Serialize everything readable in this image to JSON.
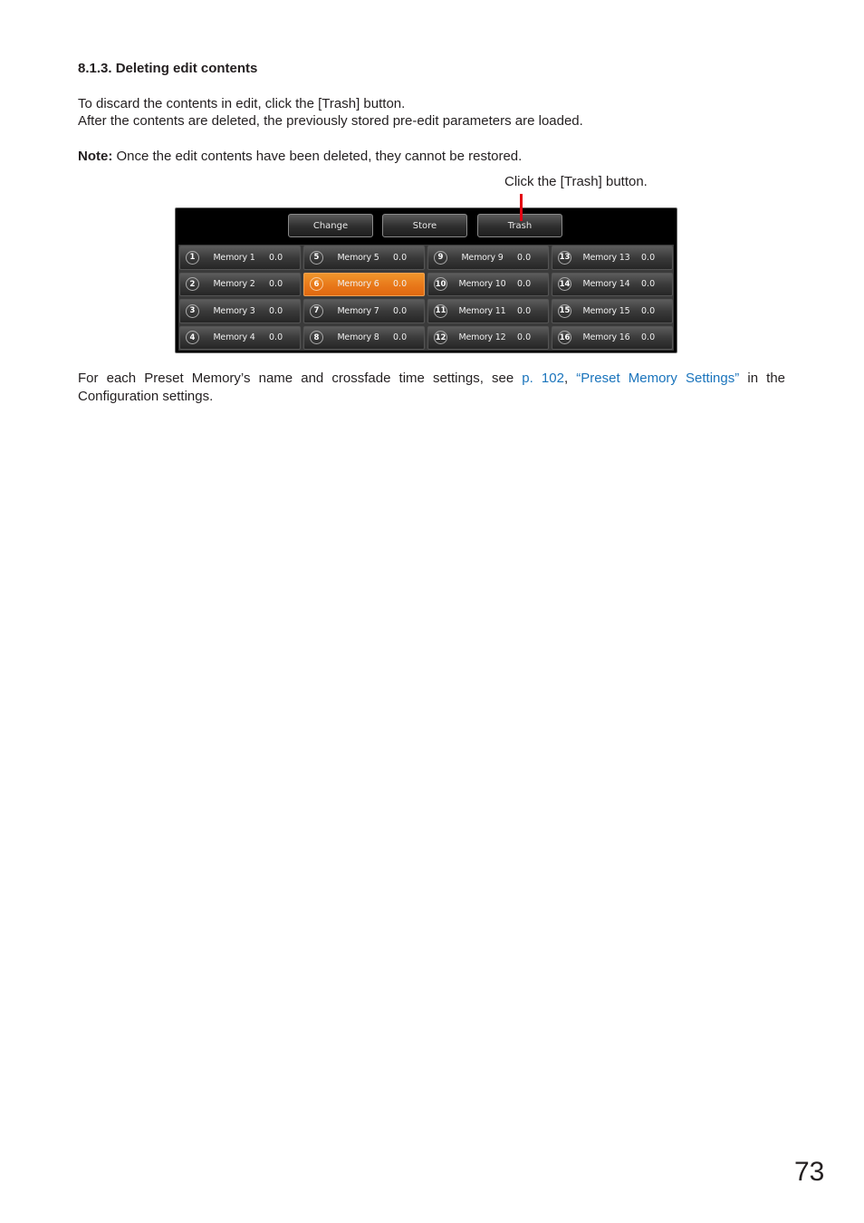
{
  "heading": "8.1.3. Deleting edit contents",
  "paragraphs": {
    "p1": "To discard the contents in edit, click the [Trash] button.",
    "p2": "After the contents are deleted, the previously stored pre-edit parameters are loaded.",
    "note_label": "Note:",
    "note_text": " Once the edit contents have been deleted, they cannot be restored."
  },
  "callout": "Click the [Trash]  button.",
  "panel": {
    "buttons": {
      "change": "Change",
      "store": "Store",
      "trash": "Trash"
    },
    "accent_color": "#e8781a",
    "memories": [
      {
        "num": "1",
        "name": "Memory 1",
        "value": "0.0"
      },
      {
        "num": "2",
        "name": "Memory 2",
        "value": "0.0"
      },
      {
        "num": "3",
        "name": "Memory 3",
        "value": "0.0"
      },
      {
        "num": "4",
        "name": "Memory 4",
        "value": "0.0"
      },
      {
        "num": "5",
        "name": "Memory 5",
        "value": "0.0"
      },
      {
        "num": "6",
        "name": "Memory 6",
        "value": "0.0",
        "active": true
      },
      {
        "num": "7",
        "name": "Memory 7",
        "value": "0.0"
      },
      {
        "num": "8",
        "name": "Memory 8",
        "value": "0.0"
      },
      {
        "num": "9",
        "name": "Memory 9",
        "value": "0.0"
      },
      {
        "num": "10",
        "name": "Memory 10",
        "value": "0.0"
      },
      {
        "num": "11",
        "name": "Memory 11",
        "value": "0.0"
      },
      {
        "num": "12",
        "name": "Memory 12",
        "value": "0.0"
      },
      {
        "num": "13",
        "name": "Memory 13",
        "value": "0.0"
      },
      {
        "num": "14",
        "name": "Memory 14",
        "value": "0.0"
      },
      {
        "num": "15",
        "name": "Memory 15",
        "value": "0.0"
      },
      {
        "num": "16",
        "name": "Memory 16",
        "value": "0.0"
      }
    ]
  },
  "footer_para": {
    "before": "For each Preset Memory’s name and crossfade time settings, see ",
    "link1": "p. 102",
    "sep": ", ",
    "link2": "“Preset Memory Settings”",
    "after": " in the Configuration settings."
  },
  "page_number": "73"
}
